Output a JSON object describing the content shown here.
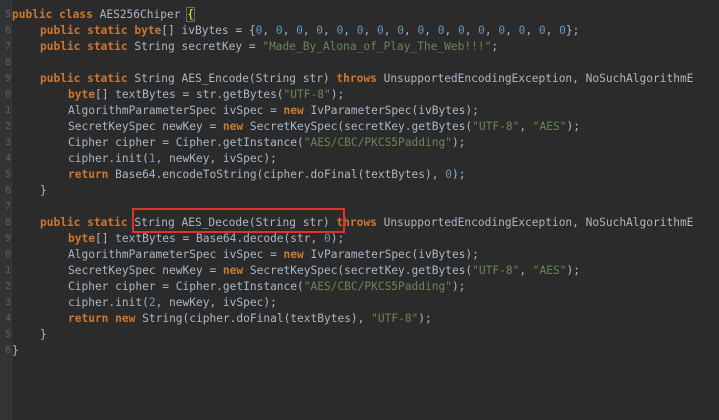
{
  "gutter": {
    "line_numbers": [
      "5",
      "6",
      "7",
      "8",
      "9",
      "0",
      "1",
      "2",
      "3",
      "4",
      "5",
      "6",
      "7",
      "8",
      "9",
      "0",
      "1",
      "2",
      "3",
      "4",
      "5",
      "6"
    ]
  },
  "code": {
    "l1": {
      "kw1": "public",
      "kw2": "class",
      "name": "AES256Chiper",
      "brace": "{"
    },
    "l2": {
      "kw1": "public",
      "kw2": "static",
      "type": "byte",
      "rest": "[] ivBytes = {",
      "zero": "0",
      "sep": ", ",
      "end": "};"
    },
    "l3": {
      "kw1": "public",
      "kw2": "static",
      "rest1": "String secretKey = ",
      "str": "\"Made_By_Alona_of_Play_The_Web!!!\"",
      "end": ";"
    },
    "l5": {
      "kw1": "public",
      "kw2": "static",
      "rest1": "String AES_Encode(String str) ",
      "kw3": "throws",
      "rest2": " UnsupportedEncodingException, NoSuchAlgorithmE"
    },
    "l6": {
      "type": "byte",
      "rest1": "[] textBytes = str.getBytes(",
      "str": "\"UTF-8\"",
      "end": ");"
    },
    "l7": {
      "rest1": "AlgorithmParameterSpec ivSpec = ",
      "kw": "new",
      "rest2": " IvParameterSpec(ivBytes);"
    },
    "l8": {
      "rest1": "SecretKeySpec newKey = ",
      "kw": "new",
      "rest2": " SecretKeySpec(secretKey.getBytes(",
      "str1": "\"UTF-8\"",
      "sep": ", ",
      "str2": "\"AES\"",
      "end": ");"
    },
    "l9": {
      "rest1": "Cipher cipher = Cipher.getInstance(",
      "str": "\"AES/CBC/PKCS5Padding\"",
      "end": ");"
    },
    "l10": {
      "rest1": "cipher.init(",
      "num": "1",
      "rest2": ", newKey, ivSpec);"
    },
    "l11": {
      "kw": "return",
      "rest1": " Base64.encodeToString(cipher.doFinal(textBytes), ",
      "num": "0",
      "end": ");"
    },
    "l12": {
      "brace": "}"
    },
    "l14": {
      "kw1": "public",
      "kw2": "static",
      "rest1": "String AES_Decode(String str) ",
      "kw3": "throws",
      "rest2": " UnsupportedEncodingException, NoSuchAlgorithmE"
    },
    "l15": {
      "type": "byte",
      "rest1": "[] textBytes = Base64.decode(str, ",
      "num": "0",
      "end": ");"
    },
    "l16": {
      "rest1": "AlgorithmParameterSpec ivSpec = ",
      "kw": "new",
      "rest2": " IvParameterSpec(ivBytes);"
    },
    "l17": {
      "rest1": "SecretKeySpec newKey = ",
      "kw": "new",
      "rest2": " SecretKeySpec(secretKey.getBytes(",
      "str1": "\"UTF-8\"",
      "sep": ", ",
      "str2": "\"AES\"",
      "end": ");"
    },
    "l18": {
      "rest1": "Cipher cipher = Cipher.getInstance(",
      "str": "\"AES/CBC/PKCS5Padding\"",
      "end": ");"
    },
    "l19": {
      "rest1": "cipher.init(",
      "num": "2",
      "rest2": ", newKey, ivSpec);"
    },
    "l20": {
      "kw": "return",
      "sp": " ",
      "kw2": "new",
      "rest1": " String(cipher.doFinal(textBytes), ",
      "str": "\"UTF-8\"",
      "end": ");"
    },
    "l21": {
      "brace": "}"
    },
    "l22": {
      "brace": "}"
    }
  },
  "colors": {
    "background": "#2b2b2b",
    "keyword": "#cc7832",
    "string": "#6a8759",
    "number": "#6897bb",
    "text": "#a9b7c6",
    "highlight_box": "#e0312d"
  }
}
